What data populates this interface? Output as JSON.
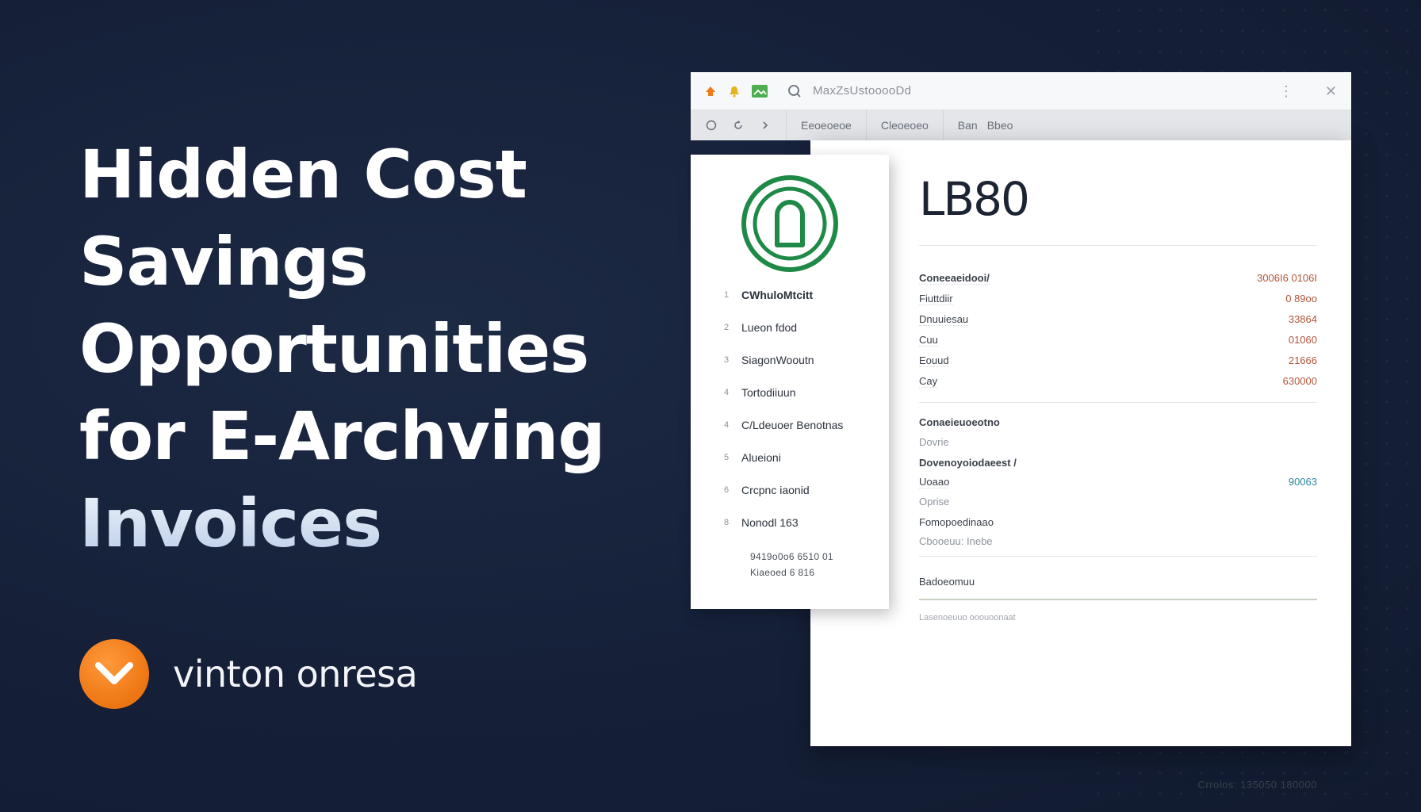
{
  "headline": {
    "lines": [
      "Hidden Cost",
      "Savings",
      "Opportunities",
      "for E-Archving"
    ],
    "accent_line": "Invoices"
  },
  "brand": {
    "name": "vinton onresa",
    "logo_icon": "chevron-down-icon",
    "color": "#f07a17"
  },
  "window": {
    "url": "MaxZsUstooooDd",
    "toolbar_menu": [
      "Eeoeoeoe",
      "Cleoeoeo",
      "Ban",
      "Bbeo"
    ],
    "window_controls": [
      "minimize-icon",
      "close-icon"
    ]
  },
  "sidebar": {
    "items": [
      {
        "num": "1",
        "label": "CWhuloMtcitt"
      },
      {
        "num": "2",
        "label": "Lueon fdod"
      },
      {
        "num": "3",
        "label": "SiagonWooutn"
      },
      {
        "num": "4",
        "label": "Tortodiiuun"
      },
      {
        "num": "4",
        "label": "C/Ldeuoer Benotnas"
      },
      {
        "num": "5",
        "label": "Alueioni"
      },
      {
        "num": "6",
        "label": "Crcpnc iaonid"
      },
      {
        "num": "8",
        "label": "Nonodl 163"
      }
    ],
    "notes": [
      "9419o0o6 6510 01",
      "Kiaeoed 6 816"
    ]
  },
  "document": {
    "title": "LB80",
    "rows": [
      {
        "label": "Coneeaeidooi/",
        "value": "3006I6 0106I"
      },
      {
        "label": "Fiuttdiir",
        "value": "0 89oo"
      },
      {
        "label": "Dnuuiesau",
        "value": "33864"
      },
      {
        "label": "Cuu",
        "value": "01060"
      },
      {
        "label": "Eouud",
        "value": "21666"
      },
      {
        "label": "Cay",
        "value": "630000"
      }
    ],
    "section2": {
      "heading": "Conaeieuoeotno",
      "sub": "Dovrie",
      "heading2": "Dovenoyoiodaeest /",
      "row_label": "Uoaao",
      "row_value": "90063",
      "sub2": "Oprise",
      "heading3": "Fomopoedinaao",
      "sub3": "Cbooeuu: Inebe"
    },
    "section3_heading": "Badoeomuu",
    "footnote": "Lasenoeuuo ooouoonaat",
    "total": "Crrolos: 135050 180000"
  },
  "colors": {
    "background": "#16213a",
    "accent_orange": "#f07a17",
    "panel_logo_green": "#1f8a47",
    "value_red": "#b0563a",
    "value_teal": "#2a8aa0"
  }
}
